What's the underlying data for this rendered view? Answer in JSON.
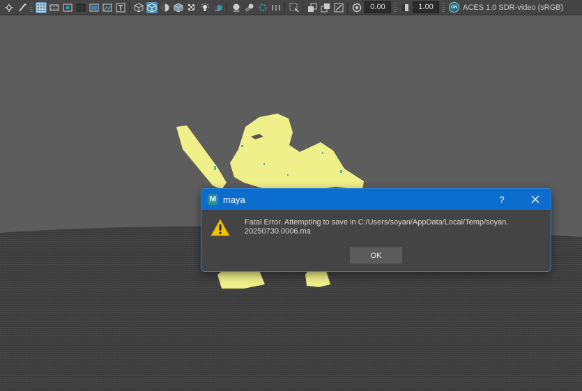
{
  "toolbar": {
    "icons": [
      "transform-gizmo-icon",
      "paint-brush-icon",
      "grid-icon",
      "film-gate-icon",
      "resolution-gate-icon",
      "gate-mask-icon",
      "field-chart-icon",
      "safe-action-icon",
      "safe-title-icon",
      "wireframe-cube-icon",
      "smooth-shaded-cube-icon",
      "default-material-icon",
      "textured-icon",
      "lights-icon",
      "shadows-icon",
      "ambient-occlusion-icon",
      "motion-blur-icon",
      "anti-aliasing-icon",
      "depth-of-field-icon",
      "isolate-select-icon",
      "xray-icon",
      "xray-joints-icon",
      "xray-components-icon",
      "camera-icon",
      "exposure-icon",
      "gamma-icon",
      "color-management-icon"
    ],
    "exposure_value": "0.00",
    "gamma_value": "1.00",
    "cm_badge": "ON",
    "color_space": "ACES 1.0 SDR-video (sRGB)"
  },
  "colors": {
    "viewport_bg": "#5d5d5d",
    "ground": "#3a3a3a",
    "character": "#f0f08a",
    "dialog_title_bar": "#0b6ecf",
    "dialog_bg": "#444444"
  },
  "dialog": {
    "title": "maya",
    "help_label": "?",
    "message_line1": "Fatal Error. Attempting to save in C:/Users/soyan/AppData/Local/Temp/soyan.",
    "message_line2": "20250730.0006.ma",
    "ok_label": "OK",
    "icon": "warning-icon"
  }
}
